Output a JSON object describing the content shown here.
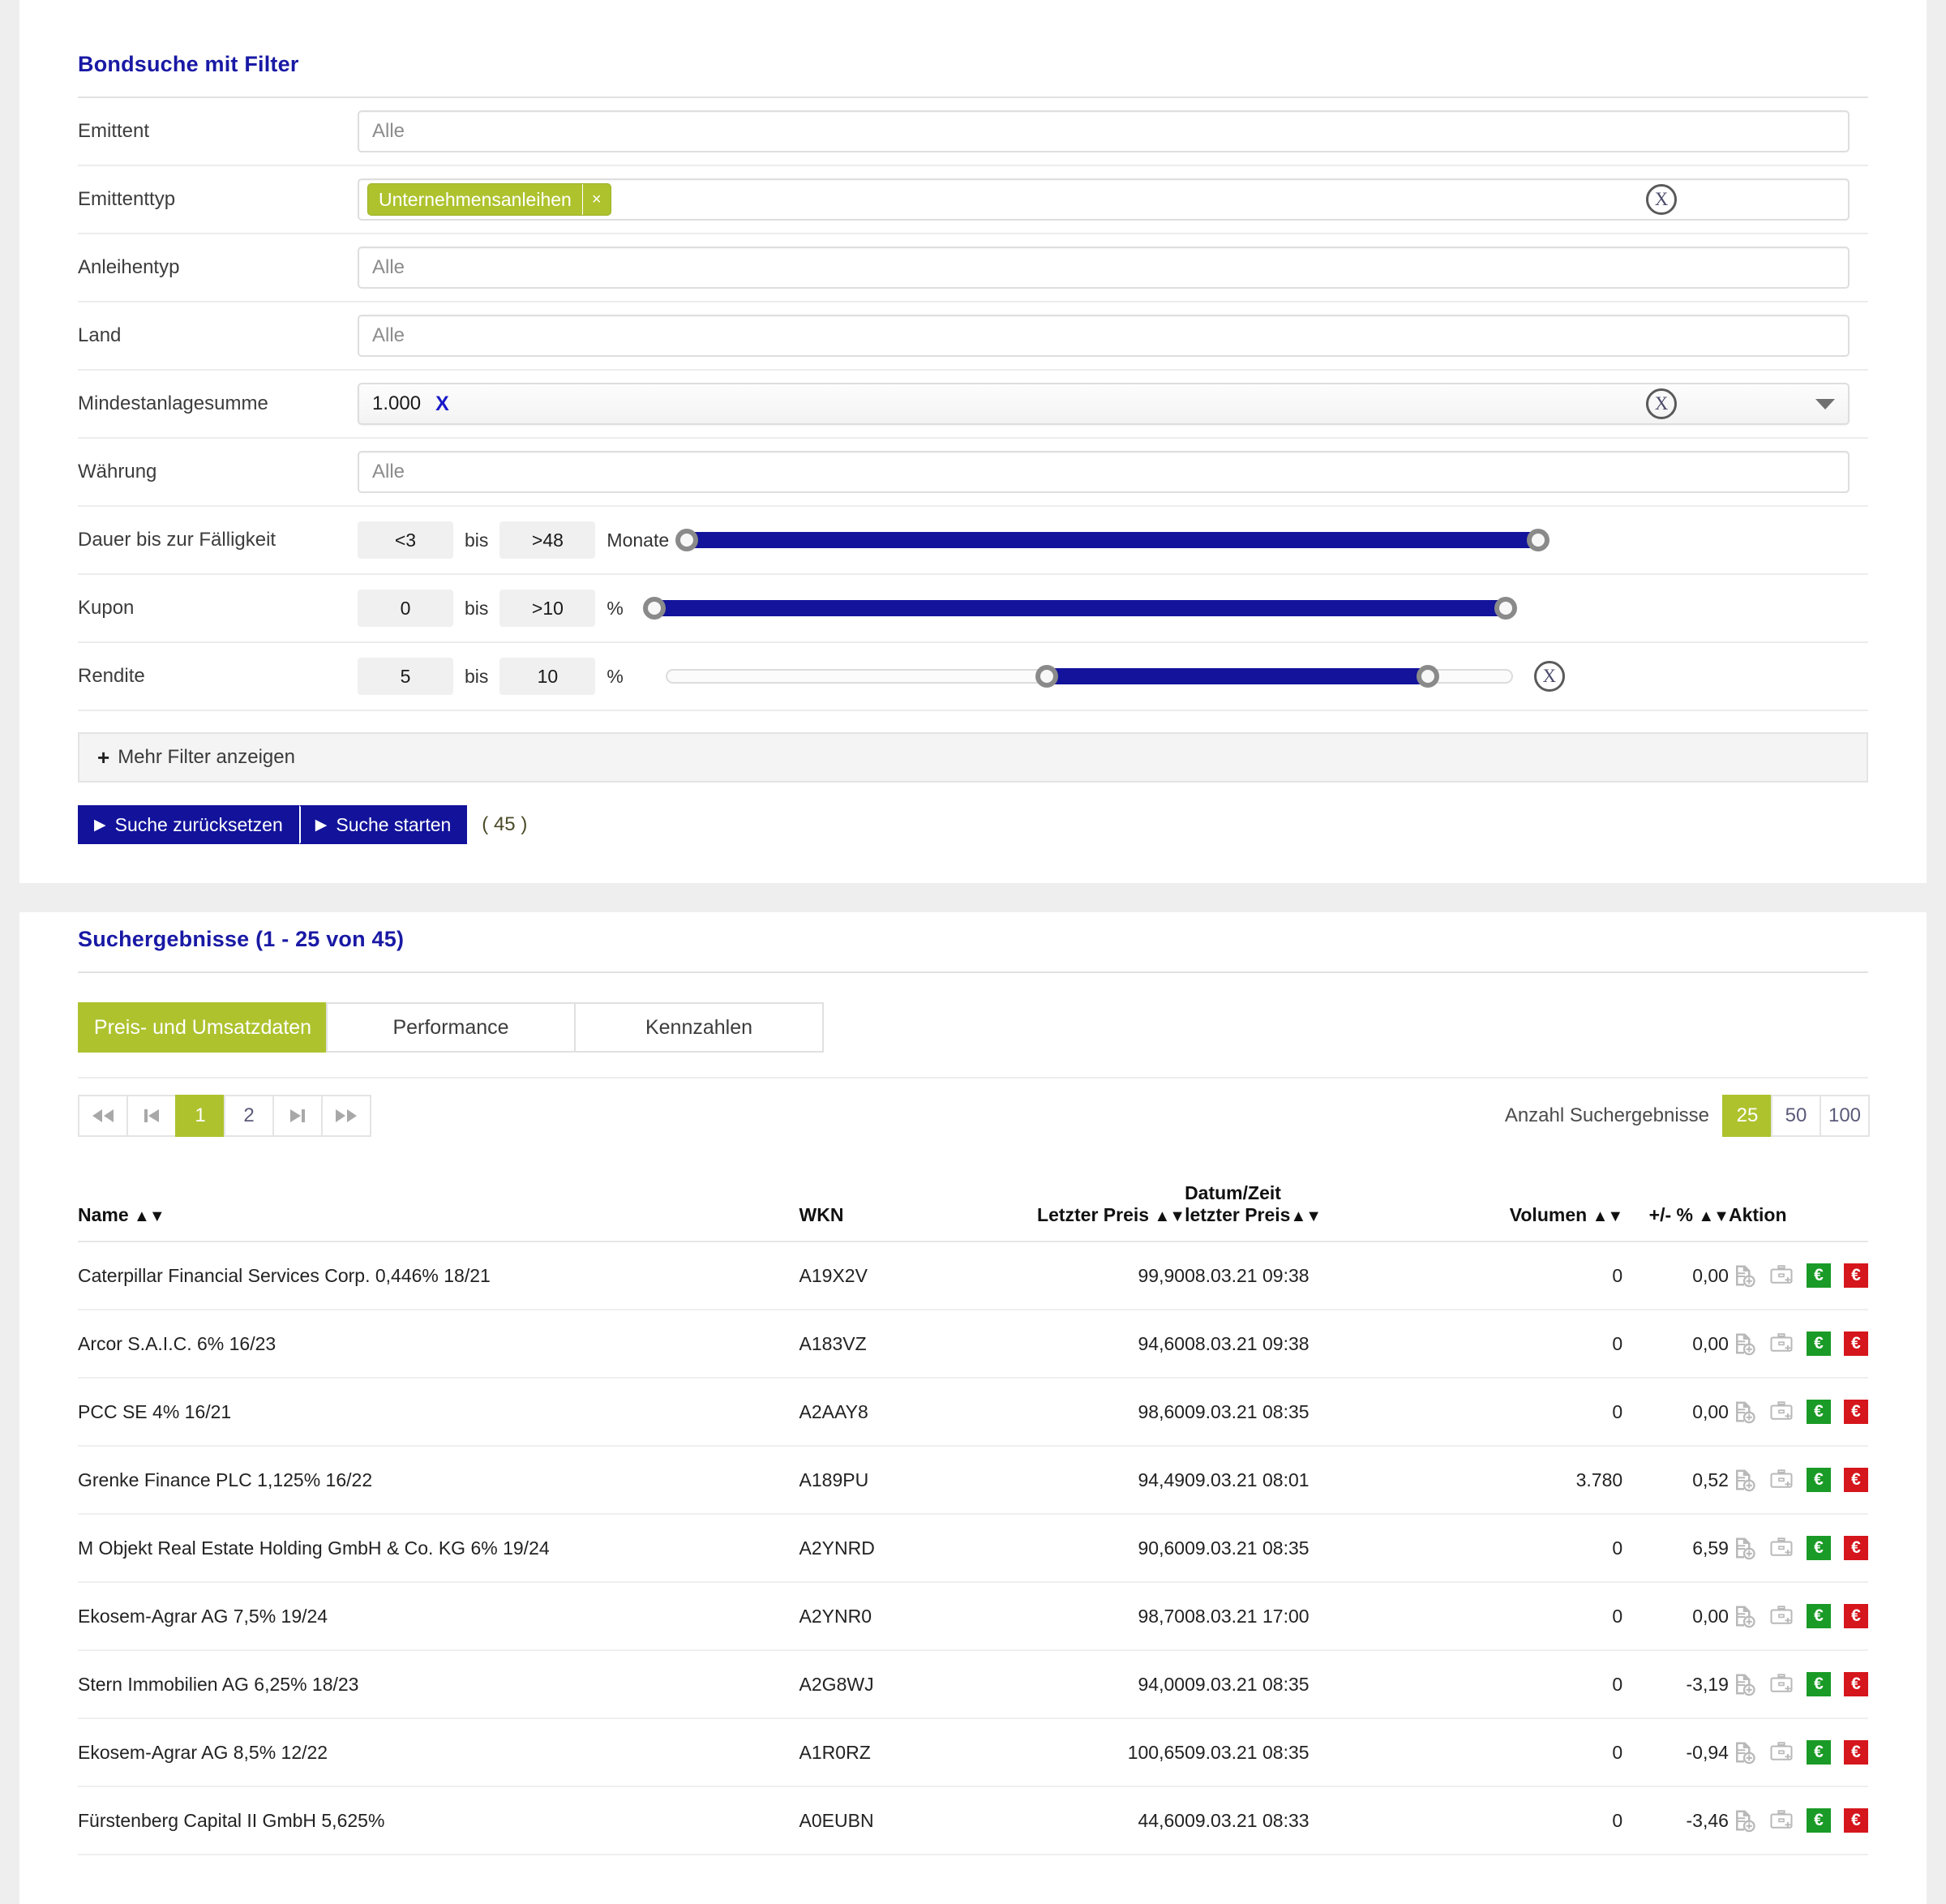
{
  "filter_panel": {
    "title": "Bondsuche mit Filter",
    "rows": [
      {
        "label": "Emittent",
        "type": "text",
        "placeholder": "Alle",
        "value": ""
      },
      {
        "label": "Emittenttyp",
        "type": "tags",
        "tags": [
          "Unternehmensanleihen"
        ],
        "tag_remove": "×",
        "has_clear": true
      },
      {
        "label": "Anleihentyp",
        "type": "text",
        "placeholder": "Alle",
        "value": ""
      },
      {
        "label": "Land",
        "type": "text",
        "placeholder": "Alle",
        "value": ""
      },
      {
        "label": "Mindestanlagesumme",
        "type": "select",
        "value": "1.000",
        "clear_x": "X",
        "has_clear": true
      },
      {
        "label": "Währung",
        "type": "text",
        "placeholder": "Alle",
        "value": ""
      }
    ],
    "ranges": [
      {
        "label": "Dauer bis zur Fälligkeit",
        "from": "<3",
        "bis": "bis",
        "to": ">48",
        "unit": "Monate",
        "slider": {
          "left_pct": 0,
          "right_pct": 100
        },
        "has_clear": false
      },
      {
        "label": "Kupon",
        "from": "0",
        "bis": "bis",
        "to": ">10",
        "unit": "%",
        "slider": {
          "left_pct": 0,
          "right_pct": 100
        },
        "has_clear": false
      },
      {
        "label": "Rendite",
        "from": "5",
        "bis": "bis",
        "to": "10",
        "unit": "%",
        "slider": {
          "left_pct": 45,
          "right_pct": 90
        },
        "has_clear": true
      }
    ],
    "more_filters": {
      "plus": "+",
      "label": "Mehr Filter anzeigen"
    },
    "buttons": {
      "reset": "Suche zurücksetzen",
      "start": "Suche starten",
      "triangle": "▶",
      "count": "( 45 )"
    }
  },
  "results_panel": {
    "title": "Suchergebnisse (1 - 25 von 45)",
    "tabs": [
      {
        "label": "Preis- und Umsatzdaten",
        "active": true
      },
      {
        "label": "Performance",
        "active": false
      },
      {
        "label": "Kennzahlen",
        "active": false
      }
    ],
    "pagination": {
      "first_label": "◀◀",
      "prev_label": "|◀",
      "pages": [
        "1",
        "2"
      ],
      "active_page": "1",
      "next_label": "▶|",
      "last_label": "▶▶",
      "count_label": "Anzahl Suchergebnisse",
      "page_sizes": [
        "25",
        "50",
        "100"
      ],
      "active_size": "25"
    },
    "table": {
      "columns": [
        {
          "label": "Name",
          "sortable": true,
          "align": "left"
        },
        {
          "label": "WKN",
          "sortable": false,
          "align": "left"
        },
        {
          "label": "Letzter Preis",
          "sortable": true,
          "align": "right"
        },
        {
          "label": "Datum/Zeit",
          "label2": "letzter Preis",
          "sortable": true,
          "align": "left"
        },
        {
          "label": "Volumen",
          "sortable": true,
          "align": "right"
        },
        {
          "label": "+/- %",
          "sortable": true,
          "align": "right"
        },
        {
          "label": "Aktion",
          "sortable": false,
          "align": "left"
        }
      ],
      "sort_arrows": "▲▼",
      "rows": [
        {
          "name": "Caterpillar Financial Services Corp. 0,446% 18/21",
          "wkn": "A19X2V",
          "price": "99,90",
          "datetime": "08.03.21 09:38",
          "volume": "0",
          "change": "0,00",
          "change_dir": "flat"
        },
        {
          "name": "Arcor S.A.I.C. 6% 16/23",
          "wkn": "A183VZ",
          "price": "94,60",
          "datetime": "08.03.21 09:38",
          "volume": "0",
          "change": "0,00",
          "change_dir": "flat"
        },
        {
          "name": "PCC SE 4% 16/21",
          "wkn": "A2AAY8",
          "price": "98,60",
          "datetime": "09.03.21 08:35",
          "volume": "0",
          "change": "0,00",
          "change_dir": "flat"
        },
        {
          "name": "Grenke Finance PLC 1,125% 16/22",
          "wkn": "A189PU",
          "price": "94,49",
          "datetime": "09.03.21 08:01",
          "volume": "3.780",
          "change": "0,52",
          "change_dir": "up"
        },
        {
          "name": "M Objekt Real Estate Holding GmbH & Co. KG 6% 19/24",
          "wkn": "A2YNRD",
          "price": "90,60",
          "datetime": "09.03.21 08:35",
          "volume": "0",
          "change": "6,59",
          "change_dir": "up"
        },
        {
          "name": "Ekosem-Agrar AG 7,5% 19/24",
          "wkn": "A2YNR0",
          "price": "98,70",
          "datetime": "08.03.21 17:00",
          "volume": "0",
          "change": "0,00",
          "change_dir": "flat"
        },
        {
          "name": "Stern Immobilien AG 6,25% 18/23",
          "wkn": "A2G8WJ",
          "price": "94,00",
          "datetime": "09.03.21 08:35",
          "volume": "0",
          "change": "-3,19",
          "change_dir": "down"
        },
        {
          "name": "Ekosem-Agrar AG 8,5% 12/22",
          "wkn": "A1R0RZ",
          "price": "100,65",
          "datetime": "09.03.21 08:35",
          "volume": "0",
          "change": "-0,94",
          "change_dir": "down"
        },
        {
          "name": "Fürstenberg Capital II GmbH 5,625%",
          "wkn": "A0EUBN",
          "price": "44,60",
          "datetime": "09.03.21 08:33",
          "volume": "0",
          "change": "-3,46",
          "change_dir": "down"
        }
      ],
      "action_icons": {
        "watchlist": "add-to-watchlist-icon",
        "portfolio": "add-to-portfolio-icon",
        "buy": "€",
        "sell": "€"
      }
    }
  },
  "colors": {
    "accent_green": "#aec22e",
    "accent_blue": "#12129b",
    "title_blue": "#1919a5",
    "up_green": "#13a313",
    "down_red": "#e01b1b",
    "buy_green": "#1a9a26",
    "sell_red": "#d5161c"
  }
}
